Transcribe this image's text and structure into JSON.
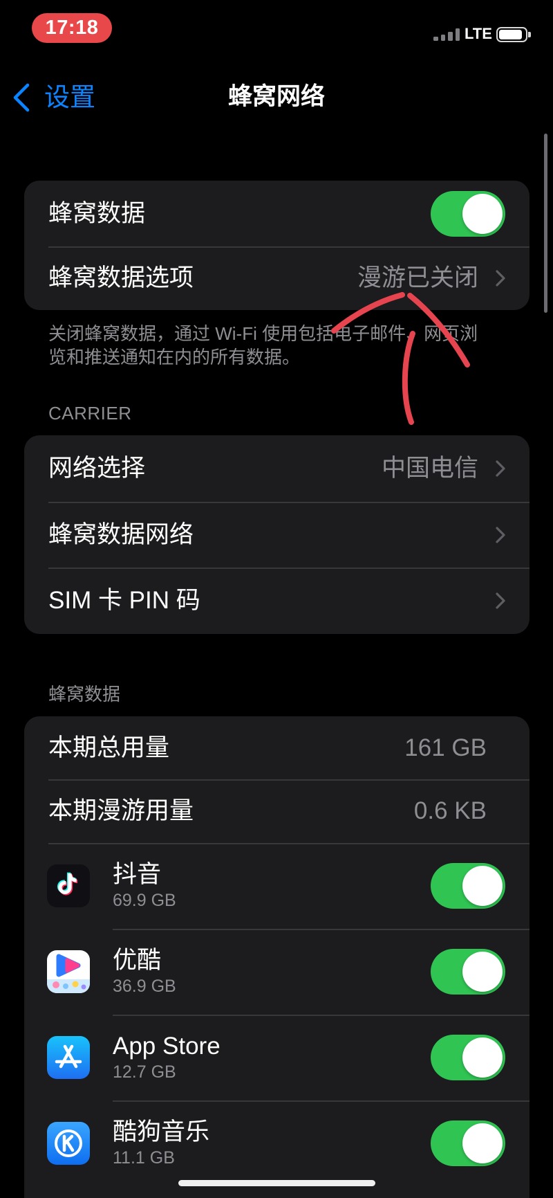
{
  "status_bar": {
    "time": "17:18",
    "network_type": "LTE",
    "battery_level": 0.92,
    "icons": {
      "signal": "cellular-signal-icon",
      "battery": "battery-icon"
    }
  },
  "nav_bar": {
    "back_label": "设置",
    "back_icon": "chevron-left-icon",
    "title": "蜂窝网络"
  },
  "cellular_section": {
    "cellular_data": {
      "label": "蜂窝数据",
      "on": true
    },
    "data_options": {
      "label": "蜂窝数据选项",
      "value": "漫游已关闭",
      "icon": "chevron-right-icon"
    },
    "footer": "关闭蜂窝数据，通过 Wi-Fi 使用包括电子邮件、网页浏览和推送通知在内的所有数据。"
  },
  "carrier_section": {
    "header": "CARRIER",
    "rows": [
      {
        "label": "网络选择",
        "value": "中国电信",
        "icon": "chevron-right-icon"
      },
      {
        "label": "蜂窝数据网络",
        "icon": "chevron-right-icon"
      },
      {
        "label": "SIM 卡 PIN 码",
        "icon": "chevron-right-icon"
      }
    ]
  },
  "usage_section": {
    "header": "蜂窝数据",
    "rows": [
      {
        "label": "本期总用量",
        "value": "161 GB"
      },
      {
        "label": "本期漫游用量",
        "value": "0.6 KB"
      }
    ],
    "apps": [
      {
        "name": "抖音",
        "usage": "69.9 GB",
        "on": true,
        "icon": "douyin-app-icon"
      },
      {
        "name": "优酷",
        "usage": "36.9 GB",
        "on": true,
        "icon": "youku-app-icon"
      },
      {
        "name": "App Store",
        "usage": "12.7 GB",
        "on": true,
        "icon": "app-store-app-icon"
      },
      {
        "name": "酷狗音乐",
        "usage": "11.1 GB",
        "on": true,
        "icon": "kugou-music-app-icon"
      }
    ]
  },
  "colors": {
    "background": "#000000",
    "card": "#1c1c1e",
    "accent_blue": "#0a84ff",
    "toggle_on": "#30c453",
    "time_pill": "#e9484a",
    "annotation_red": "#e6454f",
    "secondary_text": "#8e8e93"
  }
}
